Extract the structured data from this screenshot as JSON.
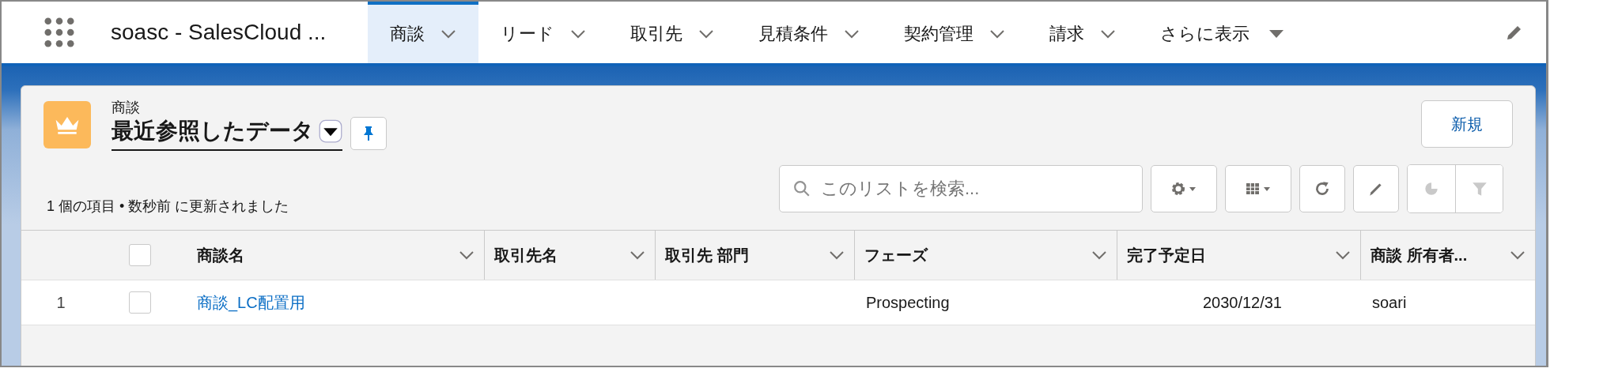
{
  "app": {
    "name": "soasc - SalesCloud ..."
  },
  "nav_tabs": [
    {
      "label": "商談",
      "selected": true,
      "kind": "menu"
    },
    {
      "label": "リード",
      "selected": false,
      "kind": "menu"
    },
    {
      "label": "取引先",
      "selected": false,
      "kind": "menu"
    },
    {
      "label": "見積条件",
      "selected": false,
      "kind": "menu"
    },
    {
      "label": "契約管理",
      "selected": false,
      "kind": "menu"
    },
    {
      "label": "請求",
      "selected": false,
      "kind": "menu"
    },
    {
      "label": "さらに表示",
      "selected": false,
      "kind": "more"
    }
  ],
  "list_header": {
    "object": "商談",
    "view": "最近参照したデータ",
    "status": "1 個の項目 • 数秒前 に更新されました",
    "new_button": "新規",
    "search": {
      "placeholder": "このリストを検索..."
    }
  },
  "table": {
    "select_all": {
      "checked": false
    },
    "columns": [
      {
        "label": "商談名"
      },
      {
        "label": "取引先名"
      },
      {
        "label": "取引先 部門"
      },
      {
        "label": "フェーズ"
      },
      {
        "label": "完了予定日"
      },
      {
        "label": "商談 所有者..."
      }
    ],
    "rows": [
      {
        "number": "1",
        "checked": false,
        "cells": [
          "商談_LC配置用",
          null,
          null,
          "Prospecting",
          "2030/12/31",
          "soari"
        ]
      }
    ]
  }
}
